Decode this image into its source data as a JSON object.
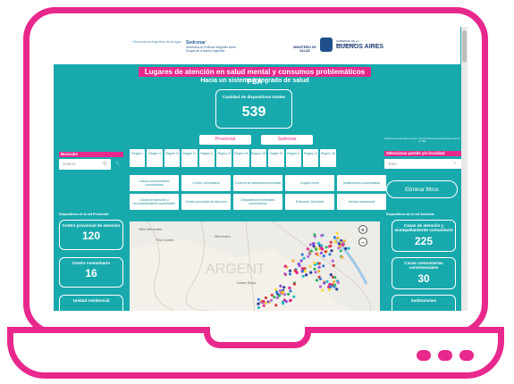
{
  "header": {
    "observatorio": "Observatorio Argentino de Drogas",
    "sedronar": "Sedronar",
    "sedronar_sub": "Secretaría de Políticas Integrales sobre Drogas de la Nación Argentina",
    "ministerio": "MINISTERIO DE SALUD",
    "gobierno": "GOBIERNO DE LA PROVINCIA DE",
    "provincia": "BUENOS AIRES"
  },
  "dashboard": {
    "title": "Lugares de atención en salud mental y consumos problemáticos PBA",
    "subtitle": "Hacia un sistema integrado de salud",
    "total_label": "Cantidad de dispositivos totales",
    "total_value": "539",
    "toggle_provincial": "Provincial",
    "toggle_sedronar": "Sedronar"
  },
  "regions": [
    {
      "label": "Región I"
    },
    {
      "label": "Región II"
    },
    {
      "label": "Región III"
    },
    {
      "label": "Región IV"
    },
    {
      "label": "Región V"
    },
    {
      "label": "Región VI"
    },
    {
      "label": "Región VII"
    },
    {
      "label": "Región VIII"
    },
    {
      "label": "Región IX"
    },
    {
      "label": "Región X"
    },
    {
      "label": "Región XI"
    },
    {
      "label": "Región XII"
    }
  ],
  "search": {
    "heading": "Buscador",
    "placeholder": "Search"
  },
  "selector": {
    "note": "Mantener presionado la tecla 'control' (Ctrl) para seleccionar más de un filtro",
    "heading": "Seleccionar partido y/o localidad",
    "value": "Todo"
  },
  "categories": [
    "Casas convivenciales comunitarias",
    "Centro comunitario",
    "Centros de asistencia inmediata",
    "Equipo móvil",
    "Instituciones conveniadas",
    "Casas de atención y acompañamiento comunitario",
    "Centro provincial de atención",
    "Dispositivos territoriales comunitarios",
    "Extensión Territorial",
    "Unidad residencial"
  ],
  "eliminar_filtros": "Eliminar filtros",
  "provincial": {
    "heading": "Dispositivos de la red Provincial",
    "cards": [
      {
        "label": "Centro provincial de atención",
        "value": "120"
      },
      {
        "label": "Centro comunitario",
        "value": "16"
      },
      {
        "label": "Unidad residencial",
        "value": ""
      }
    ]
  },
  "sedronar_red": {
    "heading": "Dispositivos de la red Sedronar",
    "cards": [
      {
        "label": "Casas de atención y acompañamiento comunitario",
        "value": "225"
      },
      {
        "label": "Casas comunitarias convivenciales",
        "value": "30"
      },
      {
        "label": "Instituciones",
        "value": ""
      }
    ]
  },
  "map": {
    "labels": [
      "Villa Mercedes",
      "Río Cuarto",
      "Mercedes",
      "Santa Rosa",
      "ARGENT"
    ],
    "dot_colors": [
      "#e8288c",
      "#f2a93b",
      "#3a7fd5",
      "#35b36b",
      "#8a4fd0",
      "#2bb6c9",
      "#d04040",
      "#f5d93b",
      "#2f3e9e",
      "#b06ad6"
    ]
  },
  "colors": {
    "accent": "#e8288c",
    "background": "#18a9ad"
  }
}
